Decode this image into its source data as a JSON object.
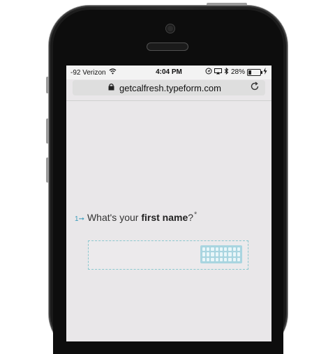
{
  "status_bar": {
    "carrier": "-92 Verizon",
    "time": "4:04 PM",
    "battery": "28%",
    "battery_level": 0.28
  },
  "browser": {
    "url": "getcalfresh.typeform.com"
  },
  "form": {
    "question_number": "1",
    "question_prefix": "What's your ",
    "question_bold": "first name",
    "question_suffix": "?",
    "required_mark": "*"
  },
  "icons": [
    "wifi-icon",
    "lock-icon",
    "reload-icon",
    "bluetooth-icon",
    "location-icon",
    "battery-icon",
    "keyboard-icon",
    "arrow-icon"
  ]
}
